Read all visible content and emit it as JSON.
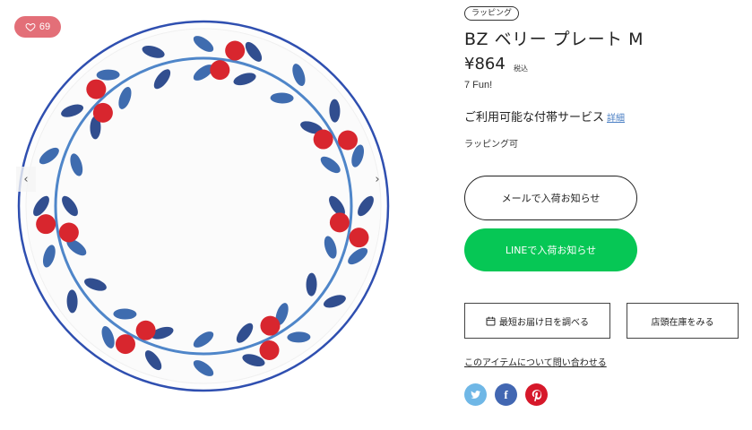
{
  "gallery": {
    "like_count": "69",
    "prev_arrow": "‹",
    "next_arrow": "›"
  },
  "product": {
    "tag": "ラッピング",
    "title": "BZ ベリー プレート M",
    "price": "¥864",
    "tax_note": "税込",
    "fun_points": "7 Fun!",
    "service_label": "ご利用可能な付帯サービス",
    "service_detail_link": "詳細",
    "wrapping_note": "ラッピング可"
  },
  "actions": {
    "mail_notify": "メールで入荷お知らせ",
    "line_notify": "LINEで入荷お知らせ",
    "delivery_check": "最短お届け日を調べる",
    "store_stock": "店頭在庫をみる",
    "inquiry": "このアイテムについて問い合わせる"
  },
  "colors": {
    "like_badge": "#e36f78",
    "line_green": "#06c755",
    "twitter": "#6fb7e6",
    "facebook": "#4267b2",
    "pinterest": "#d6182a",
    "berry_red": "#d8262e",
    "leaf_blue": "#2f5fa8",
    "rim_blue": "#2f4fb0"
  },
  "social": {
    "twitter_icon": "twitter-icon",
    "facebook_icon": "facebook-icon",
    "pinterest_icon": "pinterest-icon"
  }
}
